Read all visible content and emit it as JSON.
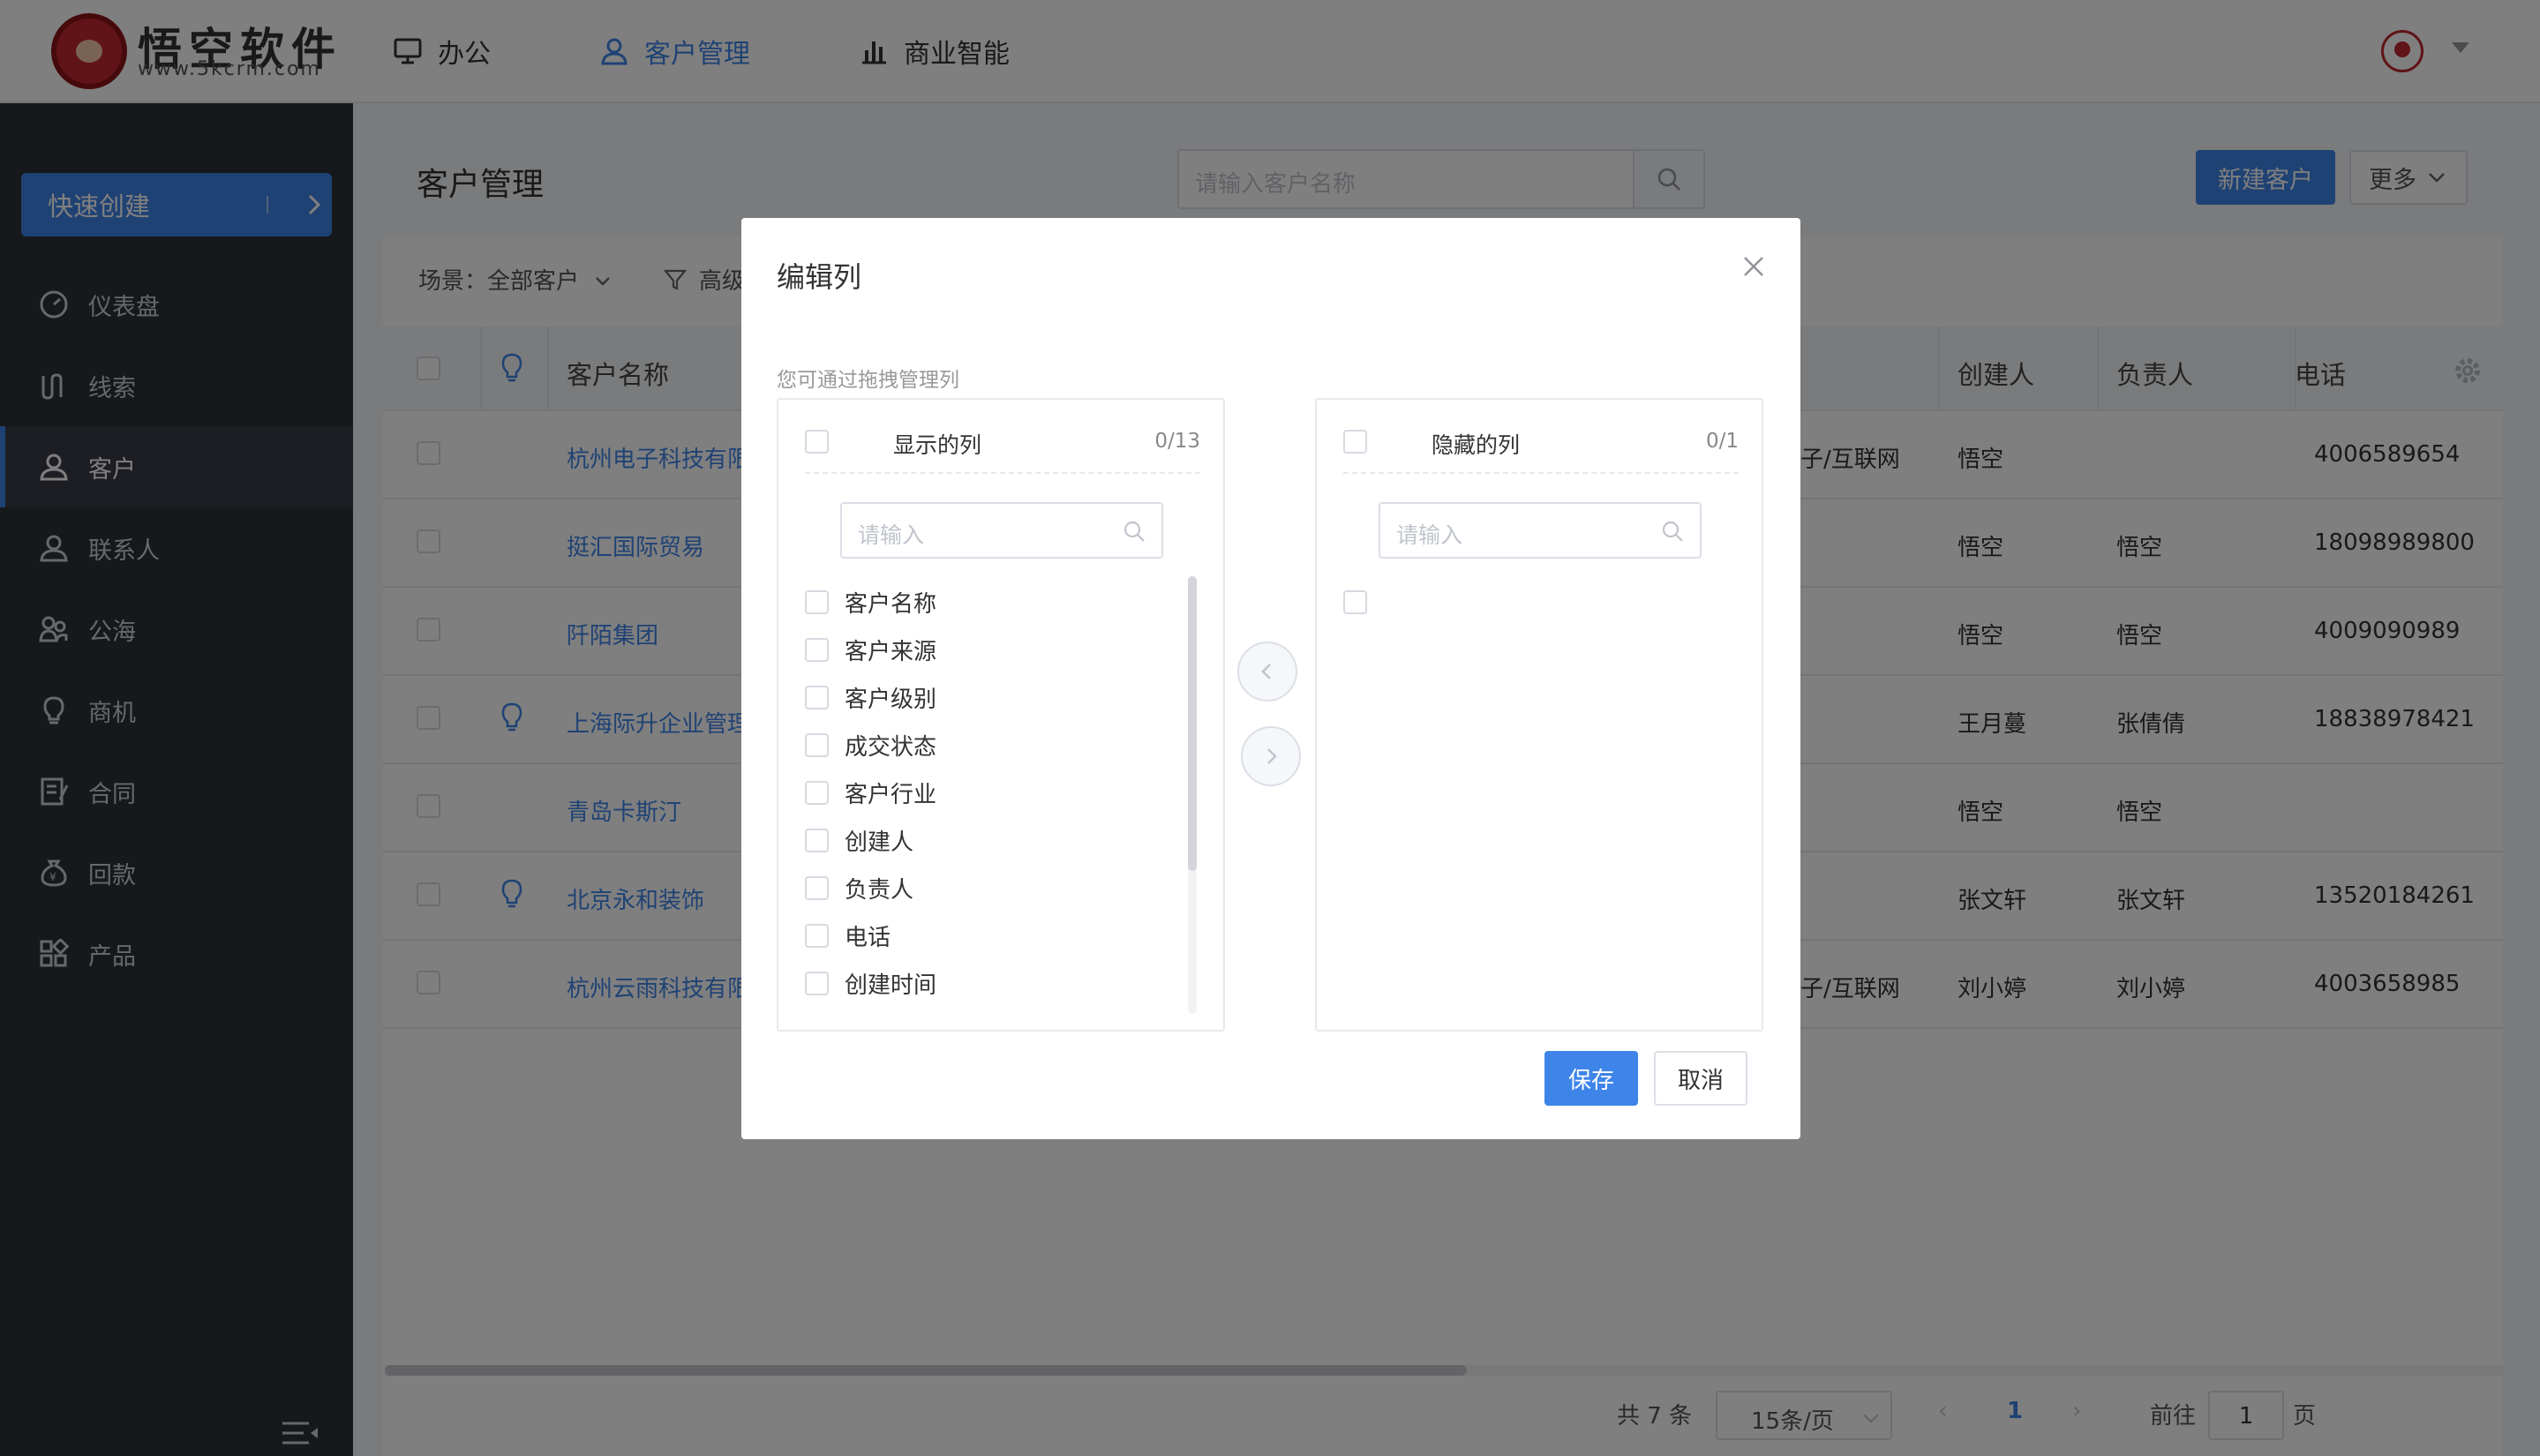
{
  "brand": {
    "name": "悟空软件",
    "url": "www.5kcrm.com"
  },
  "topnav": [
    {
      "label": "办公",
      "icon": "monitor-icon"
    },
    {
      "label": "客户管理",
      "icon": "customer-icon"
    },
    {
      "label": "商业智能",
      "icon": "bar-chart-icon"
    }
  ],
  "sidebar": {
    "quick_create": "快速创建",
    "items": [
      {
        "label": "仪表盘",
        "icon": "dashboard-icon"
      },
      {
        "label": "线索",
        "icon": "clue-icon"
      },
      {
        "label": "客户",
        "icon": "customer-icon",
        "active": true
      },
      {
        "label": "联系人",
        "icon": "contact-icon"
      },
      {
        "label": "公海",
        "icon": "pool-icon"
      },
      {
        "label": "商机",
        "icon": "bulb-icon"
      },
      {
        "label": "合同",
        "icon": "contract-icon"
      },
      {
        "label": "回款",
        "icon": "payment-icon"
      },
      {
        "label": "产品",
        "icon": "product-icon"
      }
    ]
  },
  "page": {
    "title": "客户管理",
    "search_placeholder": "请输入客户名称",
    "new_button": "新建客户",
    "more_button": "更多",
    "scene_label": "场景：全部客户",
    "filter_label": "高级筛选"
  },
  "table": {
    "headers": {
      "name": "客户名称",
      "creator": "创建人",
      "owner": "负责人",
      "phone": "电话"
    },
    "rows": [
      {
        "name": "杭州电子科技有限公司",
        "industry": "子/互联网",
        "creator": "悟空",
        "owner": "",
        "phone": "4006589654",
        "bulb": false
      },
      {
        "name": "挺汇国际贸易",
        "industry": "",
        "creator": "悟空",
        "owner": "悟空",
        "phone": "18098989800",
        "bulb": false
      },
      {
        "name": "阡陌集团",
        "industry": "",
        "creator": "悟空",
        "owner": "悟空",
        "phone": "4009090989",
        "bulb": false
      },
      {
        "name": "上海际升企业管理",
        "industry": "",
        "creator": "王月蔓",
        "owner": "张倩倩",
        "phone": "18838978421",
        "bulb": true
      },
      {
        "name": "青岛卡斯汀",
        "industry": "",
        "creator": "悟空",
        "owner": "悟空",
        "phone": "",
        "bulb": false
      },
      {
        "name": "北京永和装饰",
        "industry": "",
        "creator": "张文轩",
        "owner": "张文轩",
        "phone": "13520184261",
        "bulb": true
      },
      {
        "name": "杭州云雨科技有限公司",
        "industry": "子/互联网",
        "creator": "刘小婷",
        "owner": "刘小婷",
        "phone": "4003658985",
        "bulb": false
      }
    ]
  },
  "pagination": {
    "total": "共 7 条",
    "page_size": "15条/页",
    "current": "1",
    "goto_label": "前往",
    "goto_value": "1",
    "unit": "页"
  },
  "dialog": {
    "title": "编辑列",
    "hint": "您可通过拖拽管理列",
    "left": {
      "title": "显示的列",
      "count": "0/13",
      "placeholder": "请输入",
      "items": [
        "客户名称",
        "客户来源",
        "客户级别",
        "成交状态",
        "客户行业",
        "创建人",
        "负责人",
        "电话",
        "创建时间"
      ]
    },
    "right": {
      "title": "隐藏的列",
      "count": "0/1",
      "placeholder": "请输入"
    },
    "save": "保存",
    "cancel": "取消"
  }
}
